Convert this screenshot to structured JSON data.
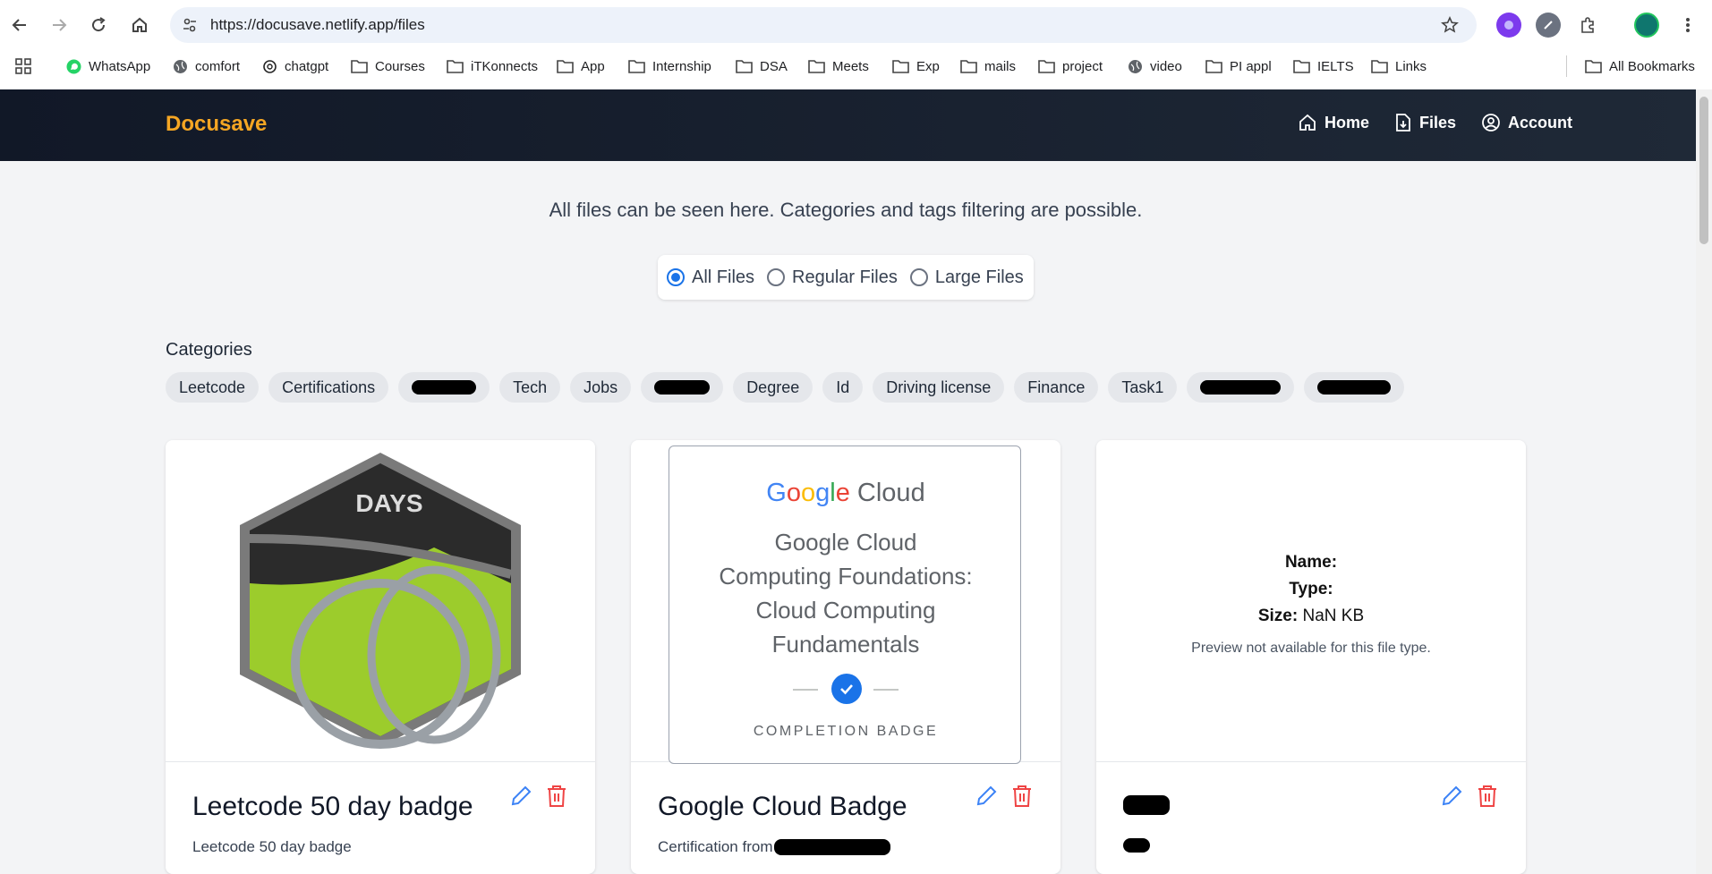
{
  "browser": {
    "url": "https://docusave.netlify.app/files",
    "bookmarks": [
      "WhatsApp",
      "comfort",
      "chatgpt",
      "Courses",
      "iTKonnects",
      "App",
      "Internship",
      "DSA",
      "Meets",
      "Exp",
      "mails",
      "project",
      "video",
      "PI appl",
      "IELTS",
      "Links"
    ],
    "all_bookmarks": "All Bookmarks"
  },
  "app": {
    "brand": "Docusave",
    "nav": {
      "home": "Home",
      "files": "Files",
      "account": "Account"
    },
    "intro": "All files can be seen here. Categories and tags filtering are possible.",
    "filters": {
      "all": "All Files",
      "regular": "Regular Files",
      "large": "Large Files",
      "selected": "All Files"
    },
    "categories_title": "Categories",
    "categories": [
      "Leetcode",
      "Certifications",
      "",
      "Tech",
      "Jobs",
      "",
      "Degree",
      "Id",
      "Driving license",
      "Finance",
      "Task1",
      "",
      ""
    ],
    "cards": [
      {
        "title": "Leetcode 50 day badge",
        "description": "Leetcode 50 day badge",
        "badge_text": "DAYS"
      },
      {
        "title": "Google Cloud Badge",
        "description": "Certification from",
        "preview": {
          "logo": "Google Cloud",
          "lines": [
            "Google Cloud",
            "Computing Foundations:",
            "Cloud Computing",
            "Fundamentals"
          ],
          "label": "COMPLETION BADGE"
        }
      },
      {
        "title": "",
        "description": "",
        "info": {
          "name_label": "Name:",
          "type_label": "Type:",
          "size_label": "Size:",
          "size_value": "NaN KB",
          "note": "Preview not available for this file type."
        }
      }
    ]
  }
}
